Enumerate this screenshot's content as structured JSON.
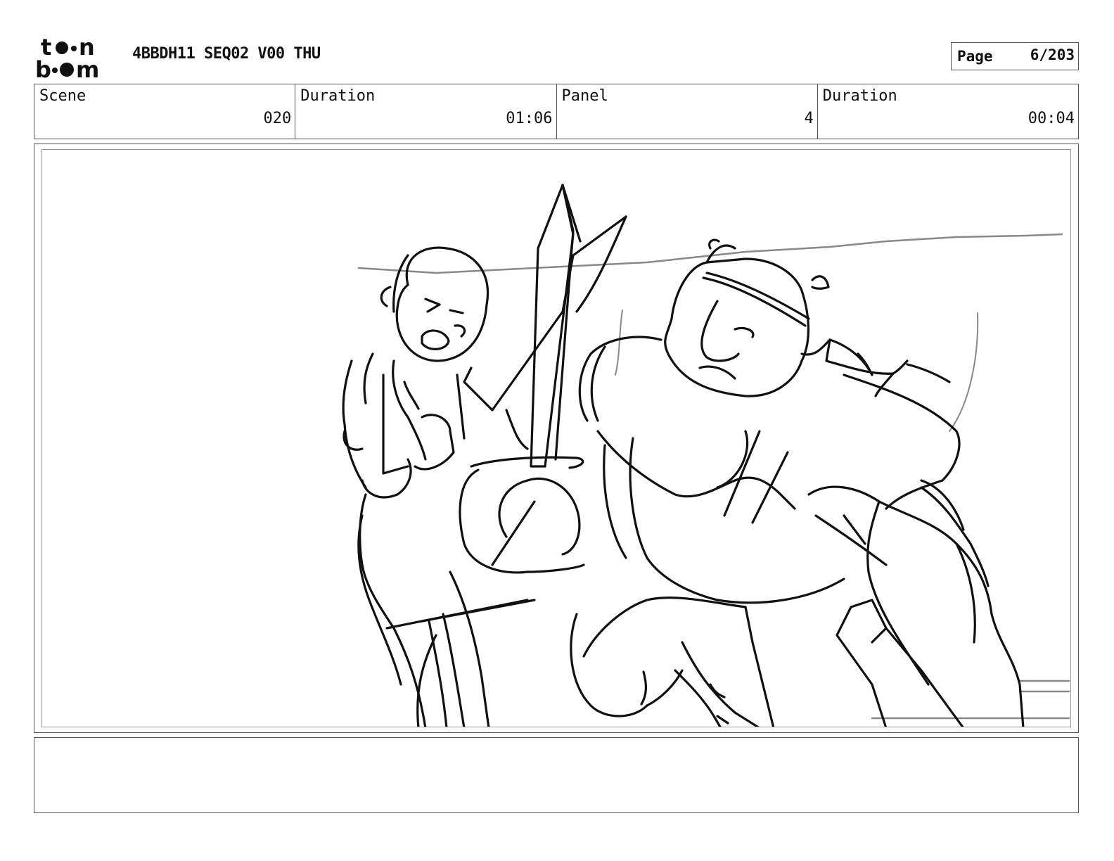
{
  "header": {
    "logo_text_top": "toon",
    "logo_text_bottom": "boom",
    "doc_title": "4BBDH11 SEQ02 V00 THU",
    "page_label": "Page",
    "page_value": "6/203"
  },
  "info": {
    "scene_label": "Scene",
    "scene_value": "020",
    "duration_label": "Duration",
    "duration_value": "01:06",
    "panel_label": "Panel",
    "panel_value": "4",
    "panel_duration_label": "Duration",
    "panel_duration_value": "00:04"
  },
  "panel_image": {
    "icon": "storyboard-sketch",
    "description_colors": {
      "line": "#111111",
      "background_line": "#888888"
    }
  },
  "notes": {
    "text": ""
  }
}
